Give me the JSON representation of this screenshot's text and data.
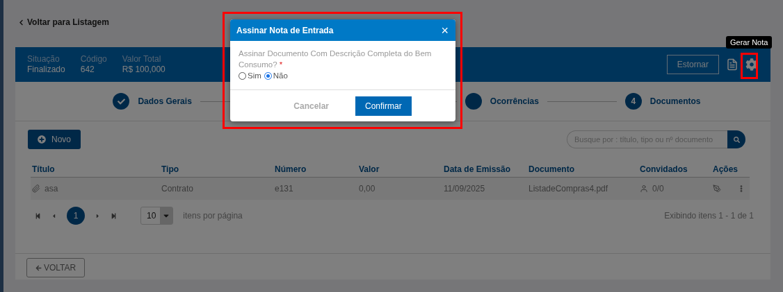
{
  "back_link": "Voltar para Listagem",
  "summary": [
    {
      "label": "Situação",
      "value": "Finalizado"
    },
    {
      "label": "Código",
      "value": "642"
    },
    {
      "label": "Valor Total",
      "value": "R$ 100,000"
    }
  ],
  "header_actions": {
    "button": "Estornar",
    "tooltip": "Gerar Nota"
  },
  "steps": [
    {
      "label": "Dados Gerais",
      "done": true
    },
    {
      "label": "Ocorrências",
      "done": false
    },
    {
      "label": "Documentos",
      "marker": "4",
      "done": false
    }
  ],
  "new_button": "Novo",
  "search": {
    "placeholder": "Busque por : título, tipo ou nº documento"
  },
  "table": {
    "columns": [
      "Título",
      "Tipo",
      "Número",
      "Valor",
      "Data de Emissão",
      "Documento",
      "Convidados",
      "Ações"
    ],
    "rows": [
      {
        "cells": [
          "asa",
          "Contrato",
          "e131",
          "0,00",
          "11/09/2025",
          "ListadeCompras4.pdf",
          "0/0"
        ]
      }
    ]
  },
  "pagination": {
    "pages": [
      {
        "label": "1",
        "selected": true
      }
    ],
    "page_size": "10",
    "page_size_label": "itens por página",
    "summary": "Exibindo itens 1 - 1 de 1"
  },
  "footer_button": "VOLTAR",
  "dialog": {
    "title": "Assinar Nota de Entrada",
    "close": "×",
    "question": "Assinar Documento Com Descrição Completa do Bem Consumo?",
    "required_mark": "*",
    "options": [
      {
        "label": "Sim",
        "selected": false
      },
      {
        "label": "Não",
        "selected": true
      }
    ],
    "buttons": [
      {
        "label": "Cancelar",
        "kind": "secondary"
      },
      {
        "label": "Confirmar",
        "kind": "primary"
      }
    ]
  }
}
